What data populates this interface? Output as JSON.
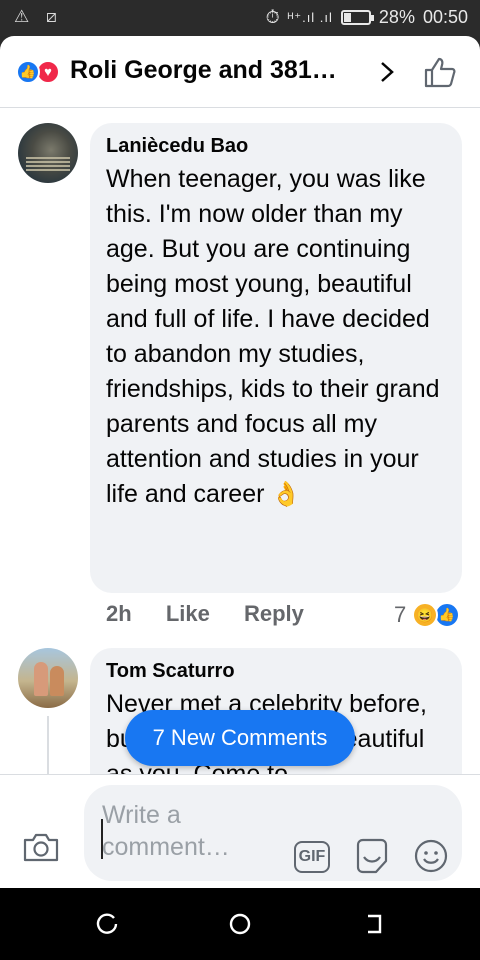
{
  "status_bar": {
    "left_icons": "⚠ ⧄",
    "signal": "ᴴ⁺.ıl .ıl",
    "battery_percent": "28%",
    "time": "00:50",
    "battery_level": 0.28
  },
  "header": {
    "title": "Roli George and 381…",
    "reactions": [
      "like-icon",
      "love-icon"
    ]
  },
  "comments": [
    {
      "author": "Lanièc​edu Bao",
      "text": "When teenager, you was like this. I'm now older than my age. But you are continuing being most young, beautiful and full of life. I have decided to abandon my studies, friendships, kids to their grand parents and  focus all my attention and studies in your life and career",
      "emoji": "👌",
      "time": "2h",
      "like_label": "Like",
      "reply_label": "Reply",
      "reaction_count": "7"
    },
    {
      "author": "Tom Scaturro",
      "text": "Never met a celebrity before, but my good, she is beautiful as you. Come to"
    }
  ],
  "new_comments_pill": "7 New Comments",
  "composer": {
    "placeholder": "Write a comment…",
    "gif_label": "GIF"
  }
}
